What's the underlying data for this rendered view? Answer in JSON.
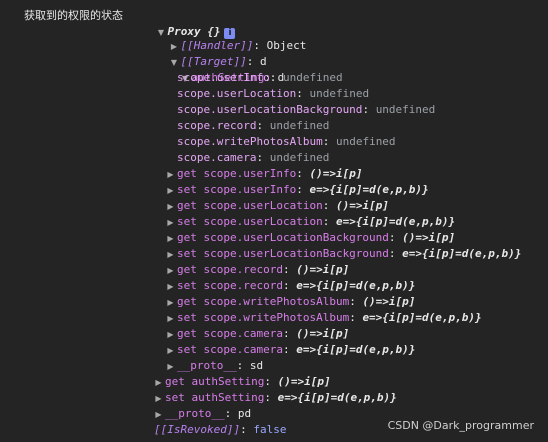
{
  "label": "获取到的权限的状态",
  "root": {
    "text": "Proxy {}",
    "info_badge": "i"
  },
  "handler": {
    "key": "[[Handler]]",
    "sep": ": ",
    "value": "Object"
  },
  "target": {
    "key": "[[Target]]",
    "sep": ": ",
    "value": "d"
  },
  "auth_setting": {
    "key": "authSetting",
    "sep": ": ",
    "value": "d"
  },
  "scopes": [
    {
      "key": "scope.userInfo",
      "sep": ": ",
      "value": "undefined"
    },
    {
      "key": "scope.userLocation",
      "sep": ": ",
      "value": "undefined"
    },
    {
      "key": "scope.userLocationBackground",
      "sep": ": ",
      "value": "undefined"
    },
    {
      "key": "scope.record",
      "sep": ": ",
      "value": "undefined"
    },
    {
      "key": "scope.writePhotosAlbum",
      "sep": ": ",
      "value": "undefined"
    },
    {
      "key": "scope.camera",
      "sep": ": ",
      "value": "undefined"
    }
  ],
  "accessors": [
    {
      "key": "get scope.userInfo",
      "sep": ": ",
      "value": "()=>i[p]"
    },
    {
      "key": "set scope.userInfo",
      "sep": ": ",
      "value": "e=>{i[p]=d(e,p,b)}"
    },
    {
      "key": "get scope.userLocation",
      "sep": ": ",
      "value": "()=>i[p]"
    },
    {
      "key": "set scope.userLocation",
      "sep": ": ",
      "value": "e=>{i[p]=d(e,p,b)}"
    },
    {
      "key": "get scope.userLocationBackground",
      "sep": ": ",
      "value": "()=>i[p]"
    },
    {
      "key": "set scope.userLocationBackground",
      "sep": ": ",
      "value": "e=>{i[p]=d(e,p,b)}"
    },
    {
      "key": "get scope.record",
      "sep": ": ",
      "value": "()=>i[p]"
    },
    {
      "key": "set scope.record",
      "sep": ": ",
      "value": "e=>{i[p]=d(e,p,b)}"
    },
    {
      "key": "get scope.writePhotosAlbum",
      "sep": ": ",
      "value": "()=>i[p]"
    },
    {
      "key": "set scope.writePhotosAlbum",
      "sep": ": ",
      "value": "e=>{i[p]=d(e,p,b)}"
    },
    {
      "key": "get scope.camera",
      "sep": ": ",
      "value": "()=>i[p]"
    },
    {
      "key": "set scope.camera",
      "sep": ": ",
      "value": "e=>{i[p]=d(e,p,b)}"
    }
  ],
  "inner_proto": {
    "key": "__proto__",
    "sep": ": ",
    "value": "sd"
  },
  "target_accessors": [
    {
      "key": "get authSetting",
      "sep": ": ",
      "value": "()=>i[p]"
    },
    {
      "key": "set authSetting",
      "sep": ": ",
      "value": "e=>{i[p]=d(e,p,b)}"
    }
  ],
  "target_proto": {
    "key": "__proto__",
    "sep": ": ",
    "value": "pd"
  },
  "is_revoked": {
    "key": "[[IsRevoked]]",
    "sep": ": ",
    "value": "false"
  },
  "watermark": "CSDN @Dark_programmer",
  "colors": {
    "background": "#242424",
    "key_purple": "#d67ee8",
    "internal_purple": "#b682ef",
    "undefined_gray": "#9aa0a6",
    "boolean_blue": "#9aa7ff",
    "badge_blue": "#7c8cf2"
  },
  "icons": {
    "expanded": "triangle-down-icon",
    "collapsed": "triangle-right-icon",
    "info": "info-badge-icon"
  }
}
